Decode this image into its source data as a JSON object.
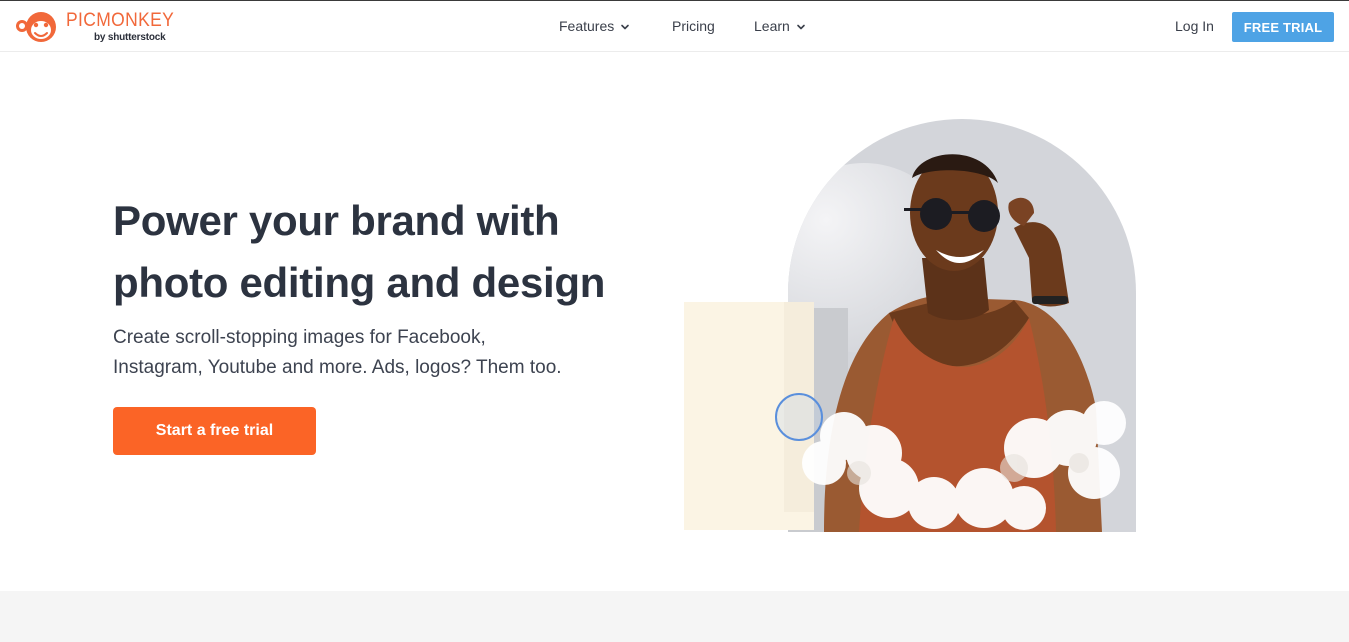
{
  "brand": {
    "name": "PICMONKEY",
    "tagline": "by shutterstock",
    "accent_color": "#f1683a",
    "logo_icon": "monkey-face-icon"
  },
  "nav": {
    "items": [
      {
        "label": "Features",
        "has_dropdown": true
      },
      {
        "label": "Pricing",
        "has_dropdown": false
      },
      {
        "label": "Learn",
        "has_dropdown": true
      }
    ],
    "login_label": "Log In",
    "trial_label": "FREE TRIAL",
    "trial_color": "#4ea3e5"
  },
  "hero": {
    "headline_line1": "Power your brand with",
    "headline_line2": "photo editing and design",
    "subcopy_line1": "Create scroll-stopping images for Facebook,",
    "subcopy_line2": "Instagram, Youtube and more. Ads, logos? Them too.",
    "cta_label": "Start a free trial",
    "cta_color": "#fb6426"
  }
}
